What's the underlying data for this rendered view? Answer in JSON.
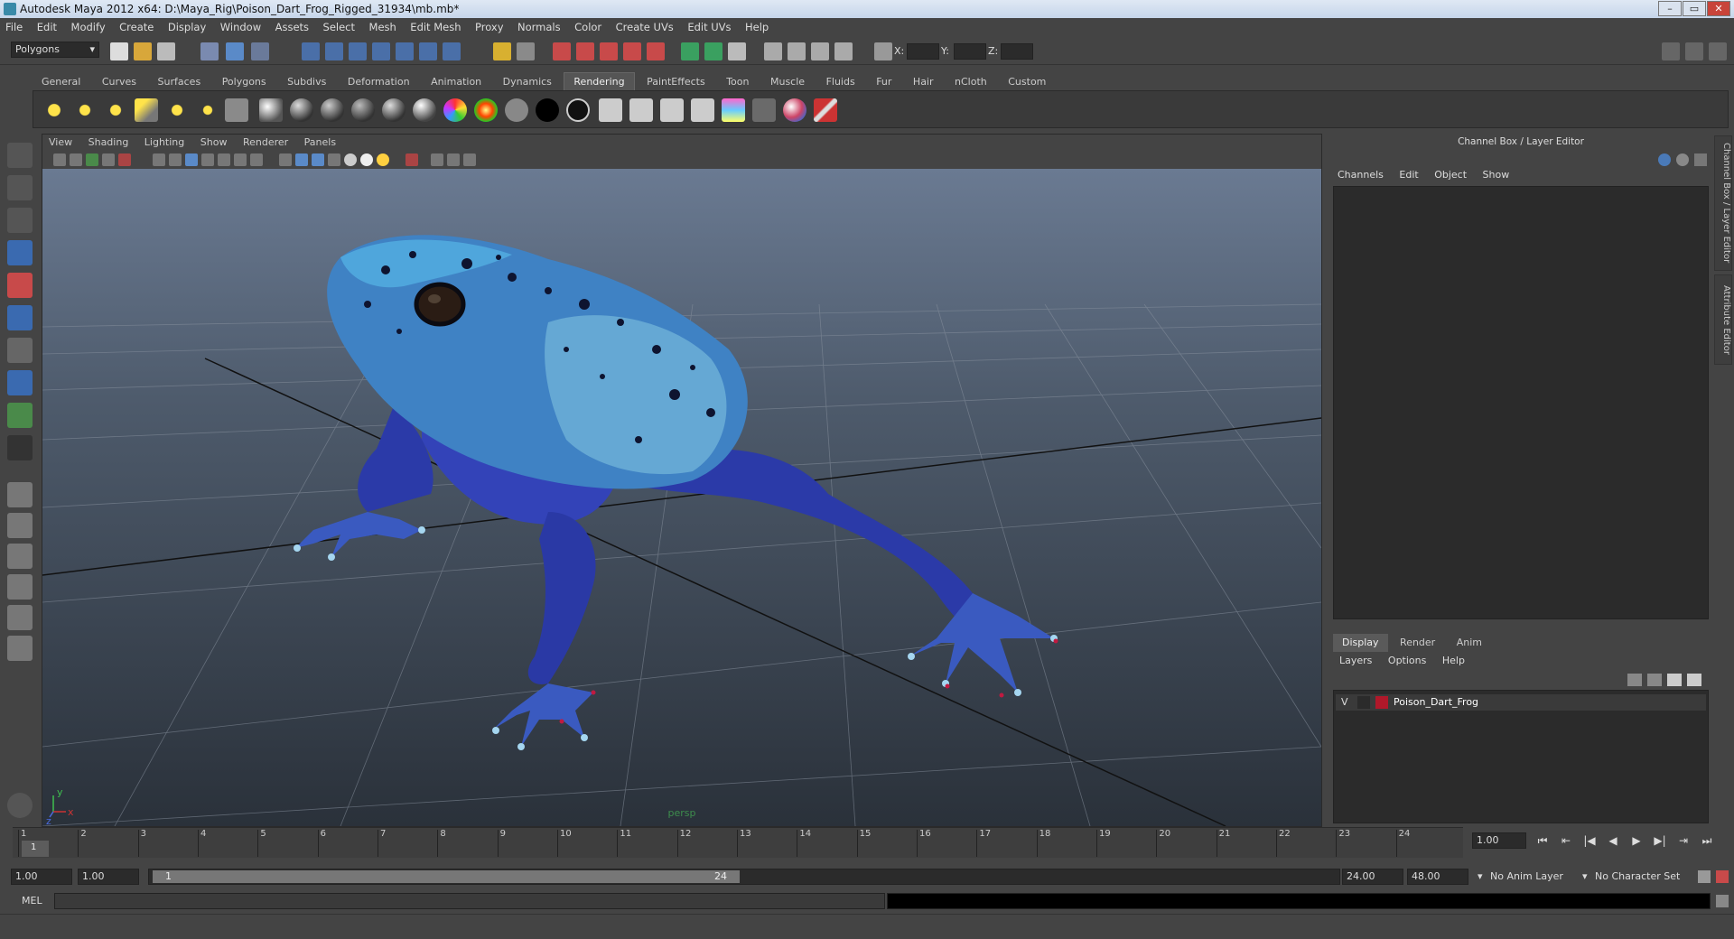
{
  "window": {
    "title": "Autodesk Maya 2012 x64: D:\\Maya_Rig\\Poison_Dart_Frog_Rigged_31934\\mb.mb*"
  },
  "menu": [
    "File",
    "Edit",
    "Modify",
    "Create",
    "Display",
    "Window",
    "Assets",
    "Select",
    "Mesh",
    "Edit Mesh",
    "Proxy",
    "Normals",
    "Color",
    "Create UVs",
    "Edit UVs",
    "Help"
  ],
  "status_line": {
    "mode": "Polygons",
    "x_label": "X:",
    "y_label": "Y:",
    "z_label": "Z:"
  },
  "shelf_tabs": [
    "General",
    "Curves",
    "Surfaces",
    "Polygons",
    "Subdivs",
    "Deformation",
    "Animation",
    "Dynamics",
    "Rendering",
    "PaintEffects",
    "Toon",
    "Muscle",
    "Fluids",
    "Fur",
    "Hair",
    "nCloth",
    "Custom"
  ],
  "active_shelf": "Rendering",
  "viewport": {
    "menu": [
      "View",
      "Shading",
      "Lighting",
      "Show",
      "Renderer",
      "Panels"
    ],
    "camera_label": "persp",
    "axis_y": "y",
    "axis_x": "x",
    "axis_z": "z"
  },
  "channel_box": {
    "title": "Channel Box / Layer Editor",
    "menu": [
      "Channels",
      "Edit",
      "Object",
      "Show"
    ]
  },
  "layer_editor": {
    "tabs": [
      "Display",
      "Render",
      "Anim"
    ],
    "active_tab": "Display",
    "menu": [
      "Layers",
      "Options",
      "Help"
    ],
    "layers": [
      {
        "visible": "V",
        "name": "Poison_Dart_Frog",
        "color": "#b0182a"
      }
    ]
  },
  "side_tabs": [
    "Channel Box / Layer Editor",
    "Attribute Editor"
  ],
  "timeline": {
    "ticks": [
      "1",
      "2",
      "3",
      "4",
      "5",
      "6",
      "7",
      "8",
      "9",
      "10",
      "11",
      "12",
      "13",
      "14",
      "15",
      "16",
      "17",
      "18",
      "19",
      "20",
      "21",
      "22",
      "23",
      "24"
    ],
    "current_time_label": "1",
    "current_frame": "1.00"
  },
  "range": {
    "start_time": "1.00",
    "playback_start": "1.00",
    "slider_start": "1",
    "slider_end": "24",
    "playback_end": "24.00",
    "end_time": "48.00",
    "anim_layer": "No Anim Layer",
    "character_set": "No Character Set"
  },
  "command_line": {
    "label": "MEL"
  },
  "colors": {
    "frog_blue": "#2e3fb0",
    "frog_light": "#5da8d8",
    "layer_red": "#b0182a",
    "shelf_active": "#555555"
  }
}
